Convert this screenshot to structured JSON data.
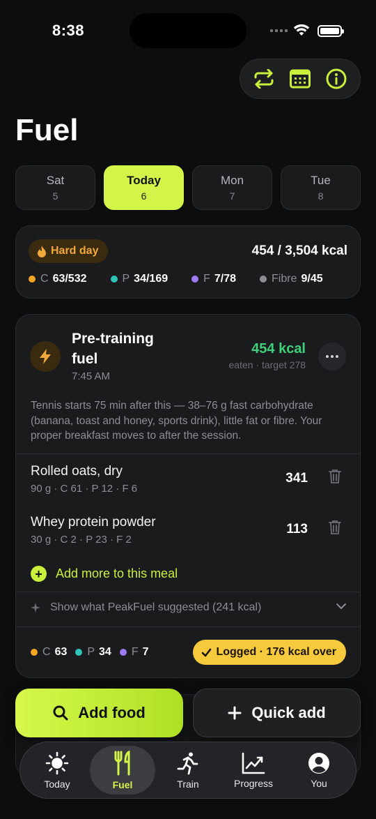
{
  "status_bar": {
    "time": "8:38"
  },
  "header": {
    "title": "Fuel"
  },
  "top_actions": [
    {
      "name": "swap-icon"
    },
    {
      "name": "calendar-icon"
    },
    {
      "name": "info-icon"
    }
  ],
  "days": [
    {
      "name": "Sat",
      "num": "5",
      "active": false
    },
    {
      "name": "Today",
      "num": "6",
      "active": true
    },
    {
      "name": "Mon",
      "num": "7",
      "active": false
    },
    {
      "name": "Tue",
      "num": "8",
      "active": false
    }
  ],
  "summary": {
    "badge": "Hard day",
    "kcal": "454 / 3,504 kcal",
    "macros": [
      {
        "label": "C",
        "value": "63/532",
        "color": "#f5a623"
      },
      {
        "label": "P",
        "value": "34/169",
        "color": "#2ec4b6"
      },
      {
        "label": "F",
        "value": "7/78",
        "color": "#9b7bf0"
      },
      {
        "label": "Fibre",
        "value": "9/45",
        "color": "#8d8e93"
      }
    ]
  },
  "meal": {
    "title": "Pre-training fuel",
    "time": "7:45 AM",
    "kcal": "454 kcal",
    "sub": "eaten · target 278",
    "note": "Tennis starts 75 min after this — 38–76 g fast carbohydrate (banana, toast and honey, sports drink), little fat or fibre. Your proper breakfast moves to after the session.",
    "foods": [
      {
        "name": "Rolled oats, dry",
        "meta": "90 g · C 61 · P 12 · F 6",
        "kcal": "341"
      },
      {
        "name": "Whey protein powder",
        "meta": "30 g · C 2 · P 23 · F 2",
        "kcal": "113"
      }
    ],
    "add_more": "Add more to this meal",
    "suggest": "Show what PeakFuel suggested (241 kcal)",
    "macros": [
      {
        "label": "C",
        "value": "63",
        "color": "#f5a623"
      },
      {
        "label": "P",
        "value": "34",
        "color": "#2ec4b6"
      },
      {
        "label": "F",
        "value": "7",
        "color": "#9b7bf0"
      }
    ],
    "status": "Logged · 176 kcal over"
  },
  "actions": {
    "add_food": "Add food",
    "quick_add": "Quick add"
  },
  "tabs": [
    {
      "label": "Today",
      "icon": "sun-icon"
    },
    {
      "label": "Fuel",
      "icon": "fork-knife-icon",
      "active": true
    },
    {
      "label": "Train",
      "icon": "runner-icon"
    },
    {
      "label": "Progress",
      "icon": "chart-icon"
    },
    {
      "label": "You",
      "icon": "person-icon"
    }
  ],
  "colors": {
    "accent": "#d3f54a",
    "green": "#3fd07a",
    "warning": "#f7c93c",
    "background": "#0d0d0e"
  }
}
